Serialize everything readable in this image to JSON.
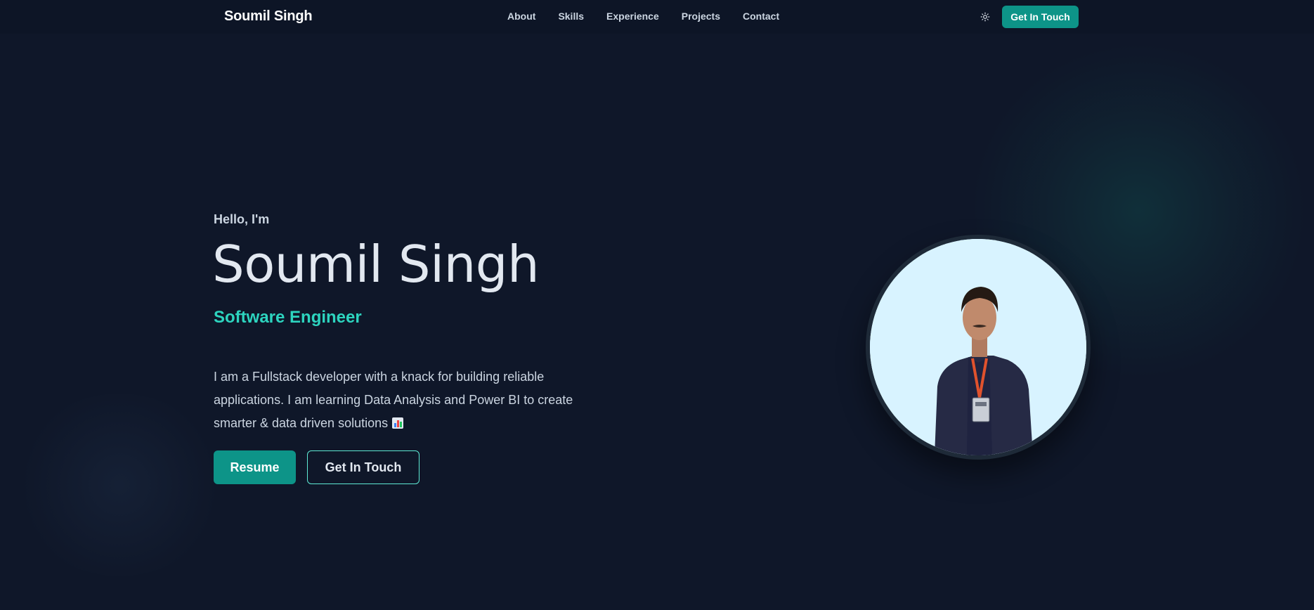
{
  "colors": {
    "background": "#0f1729",
    "accent": "#0d9488",
    "accent_text": "#2dd4bf",
    "outline": "#5eead4"
  },
  "nav": {
    "brand": "Soumil Singh",
    "links": [
      "About",
      "Skills",
      "Experience",
      "Projects",
      "Contact"
    ],
    "theme_icon": "sun-icon",
    "cta_label": "Get In Touch"
  },
  "hero": {
    "greeting": "Hello, I'm",
    "name": "Soumil Singh",
    "role": "Software Engineer",
    "description": "I am a Fullstack developer with a knack for building reliable applications. I am learning Data Analysis and Power BI to create smarter & data driven solutions",
    "description_icon": "bar-chart-emoji-icon",
    "resume_label": "Resume",
    "contact_label": "Get In Touch",
    "photo_alt": "Profile photo"
  }
}
